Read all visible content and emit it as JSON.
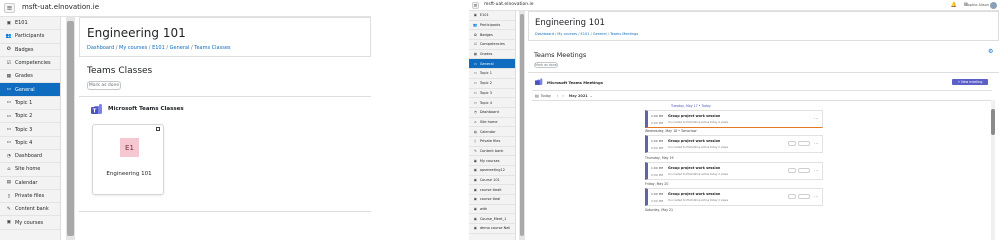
{
  "left": {
    "topbar": {
      "site": "msft-uat.elnovation.ie"
    },
    "course": {
      "title": "Engineering 101"
    },
    "breadcrumb": [
      "Dashboard",
      "My courses",
      "E101",
      "General",
      "Teams Classes"
    ],
    "section_title": "Teams Classes",
    "mark_done": "Mark as done",
    "teams_header": "Microsoft Teams Classes",
    "card": {
      "tile": "E1",
      "name": "Engineering 101"
    },
    "nav": [
      {
        "label": "E101",
        "icon": "graduation-cap-icon",
        "glyph": "▣"
      },
      {
        "label": "Participants",
        "icon": "users-icon",
        "glyph": "👥"
      },
      {
        "label": "Badges",
        "icon": "badge-icon",
        "glyph": "✪"
      },
      {
        "label": "Competencies",
        "icon": "check-list-icon",
        "glyph": "☑"
      },
      {
        "label": "Grades",
        "icon": "table-icon",
        "glyph": "▦"
      },
      {
        "label": "General",
        "icon": "folder-icon",
        "glyph": "▭",
        "active": true
      },
      {
        "label": "Topic 1",
        "icon": "folder-icon",
        "glyph": "▭"
      },
      {
        "label": "Topic 2",
        "icon": "folder-icon",
        "glyph": "▭"
      },
      {
        "label": "Topic 3",
        "icon": "folder-icon",
        "glyph": "▭"
      },
      {
        "label": "Topic 4",
        "icon": "folder-icon",
        "glyph": "▭"
      },
      {
        "label": "Dashboard",
        "icon": "dashboard-icon",
        "glyph": "◔"
      },
      {
        "label": "Site home",
        "icon": "home-icon",
        "glyph": "⌂"
      },
      {
        "label": "Calendar",
        "icon": "calendar-icon",
        "glyph": "▤"
      },
      {
        "label": "Private files",
        "icon": "file-icon",
        "glyph": "▯"
      },
      {
        "label": "Content bank",
        "icon": "pencil-icon",
        "glyph": "✎"
      },
      {
        "label": "My courses",
        "icon": "graduation-cap-icon",
        "glyph": "▣"
      }
    ]
  },
  "right": {
    "topbar": {
      "site": "msft-uat.elnovation.ie",
      "user": "Sophie Alison"
    },
    "course": {
      "title": "Engineering 101"
    },
    "breadcrumb": [
      "Dashboard",
      "My courses",
      "E101",
      "General",
      "Teams Meetings"
    ],
    "section_title": "Teams Meetings",
    "mark_done": "Mark as done",
    "teams_header": "Microsoft Teams Meetings",
    "new_meeting": "+ New meeting",
    "toolbar": {
      "today": "Today",
      "month": "May 2021"
    },
    "nav": [
      {
        "label": "E101",
        "icon": "graduation-cap-icon",
        "glyph": "▣"
      },
      {
        "label": "Participants",
        "icon": "users-icon",
        "glyph": "👥"
      },
      {
        "label": "Badges",
        "icon": "badge-icon",
        "glyph": "✪"
      },
      {
        "label": "Competencies",
        "icon": "check-list-icon",
        "glyph": "☑"
      },
      {
        "label": "Grades",
        "icon": "table-icon",
        "glyph": "▦"
      },
      {
        "label": "General",
        "icon": "folder-icon",
        "glyph": "▭",
        "active": true
      },
      {
        "label": "Topic 1",
        "icon": "folder-icon",
        "glyph": "▭"
      },
      {
        "label": "Topic 2",
        "icon": "folder-icon",
        "glyph": "▭"
      },
      {
        "label": "Topic 3",
        "icon": "folder-icon",
        "glyph": "▭"
      },
      {
        "label": "Topic 4",
        "icon": "folder-icon",
        "glyph": "▭"
      },
      {
        "label": "Dashboard",
        "icon": "dashboard-icon",
        "glyph": "◔"
      },
      {
        "label": "Site home",
        "icon": "home-icon",
        "glyph": "⌂"
      },
      {
        "label": "Calendar",
        "icon": "calendar-icon",
        "glyph": "▤"
      },
      {
        "label": "Private files",
        "icon": "file-icon",
        "glyph": "▯"
      },
      {
        "label": "Content bank",
        "icon": "pencil-icon",
        "glyph": "✎"
      },
      {
        "label": "My courses",
        "icon": "graduation-cap-icon",
        "glyph": "▣"
      },
      {
        "label": "opsmeeting12",
        "icon": "graduation-cap-icon",
        "glyph": "▣"
      },
      {
        "label": "Course 101",
        "icon": "graduation-cap-icon",
        "glyph": "▣"
      },
      {
        "label": "course tlealt",
        "icon": "graduation-cap-icon",
        "glyph": "▣"
      },
      {
        "label": "course tleal",
        "icon": "graduation-cap-icon",
        "glyph": "▣"
      },
      {
        "label": "with",
        "icon": "graduation-cap-icon",
        "glyph": "▣"
      },
      {
        "label": "Course_Meet_1",
        "icon": "graduation-cap-icon",
        "glyph": "▣"
      },
      {
        "label": "demo course Neil",
        "icon": "graduation-cap-icon",
        "glyph": "▣"
      }
    ],
    "days": [
      {
        "heading": "Tuesday, May 17  •  Today",
        "today": true,
        "meeting": {
          "time": "1:00 PM",
          "end": "2:00 PM",
          "title": "Group project work session",
          "sub": "You invited to PhotoShop  Active today  2 views"
        }
      },
      {
        "heading": "Wednesday, May 18  •  Tomorrow",
        "meeting": {
          "time": "1:00 PM",
          "end": "2:00 PM",
          "title": "Group project work session",
          "sub": "You invited to PhotoShop  Active today  2 views"
        }
      },
      {
        "heading": "Thursday, May 19",
        "meeting": {
          "time": "1:00 PM",
          "end": "2:00 PM",
          "title": "Group project work session",
          "sub": "You invited to PhotoShop  Active today  2 views"
        }
      },
      {
        "heading": "Friday, May 20",
        "meeting": {
          "time": "1:00 PM",
          "end": "2:00 PM",
          "title": "Group project work session",
          "sub": "You invited to PhotoShop  Active today  2 views"
        }
      },
      {
        "heading": "Saturday, May 21"
      }
    ]
  }
}
